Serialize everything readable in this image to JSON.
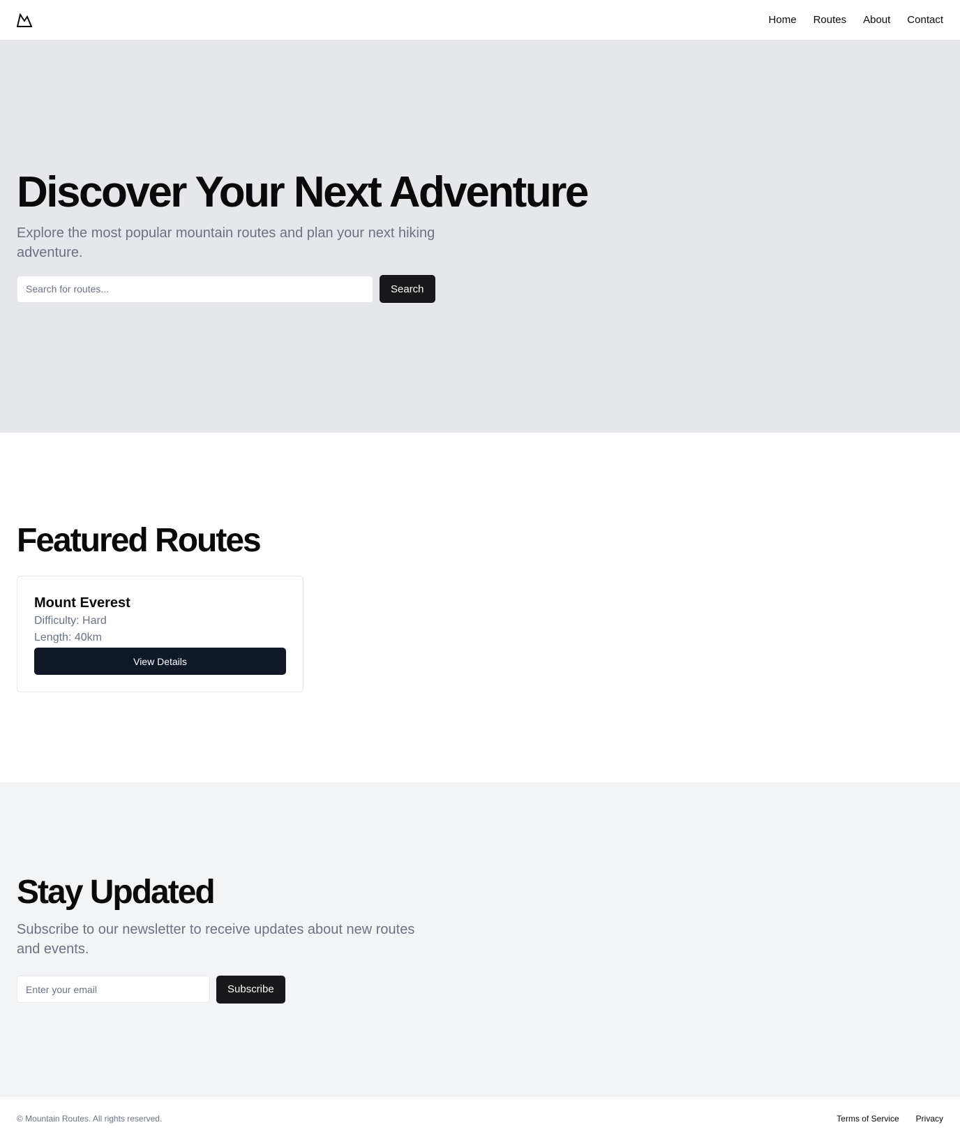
{
  "header": {
    "logo_icon": "mountain-icon",
    "nav": [
      "Home",
      "Routes",
      "About",
      "Contact"
    ]
  },
  "hero": {
    "title": "Discover Your Next Adventure",
    "subtitle": "Explore the most popular mountain routes and plan your next hiking adventure.",
    "search_placeholder": "Search for routes...",
    "search_button": "Search"
  },
  "featured": {
    "title": "Featured Routes",
    "routes": [
      {
        "name": "Mount Everest",
        "difficulty": "Difficulty: Hard",
        "length": "Length: 40km",
        "button": "View Details"
      }
    ]
  },
  "newsletter": {
    "title": "Stay Updated",
    "subtitle": "Subscribe to our newsletter to receive updates about new routes and events.",
    "email_placeholder": "Enter your email",
    "subscribe_button": "Subscribe"
  },
  "footer": {
    "copyright": "© Mountain Routes. All rights reserved.",
    "links": [
      "Terms of Service",
      "Privacy"
    ]
  },
  "colors": {
    "hero_bg": "#e5e7eb",
    "newsletter_bg": "#f3f4f6",
    "button_dark": "#18181b",
    "card_button": "#111827",
    "muted_text": "#6b7280"
  }
}
